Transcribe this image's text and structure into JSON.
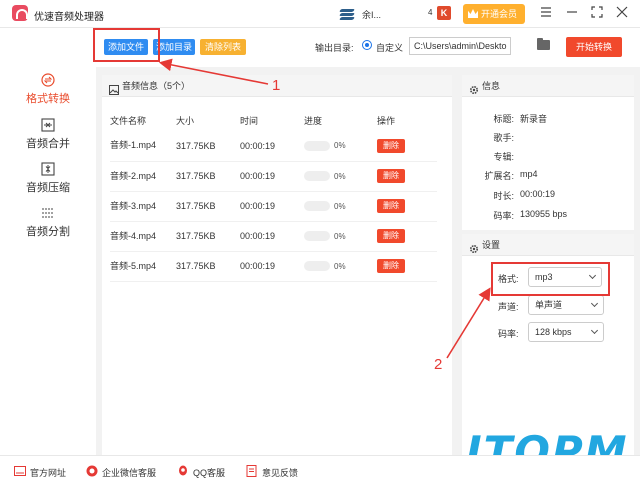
{
  "titlebar": {
    "app_title": "优速音频处理器",
    "user_name": "余I...",
    "user_suffix": "4",
    "vip_label": "开通会员",
    "icons": [
      "logo-icon",
      "user-badge-icon",
      "k-icon",
      "crown-icon",
      "menu-icon",
      "minimize-icon",
      "maximize-icon",
      "close-icon"
    ]
  },
  "sidebar": {
    "items": [
      {
        "label": "格式转换",
        "icon": "format-convert-icon",
        "active": true
      },
      {
        "label": "音频合并",
        "icon": "merge-icon",
        "active": false
      },
      {
        "label": "音频压缩",
        "icon": "compress-icon",
        "active": false
      },
      {
        "label": "音频分割",
        "icon": "split-icon",
        "active": false
      }
    ]
  },
  "toolbar": {
    "add_file": "添加文件",
    "add_dir": "添加目录",
    "clear_list": "清除列表",
    "output_label": "输出目录:",
    "custom_label": "自定义",
    "path_value": "C:\\Users\\admin\\Deskto",
    "start_label": "开始转换",
    "colors": {
      "add_file": "#2f8cf1",
      "add_dir": "#2f8cf1",
      "clear_list": "#f7b131",
      "start": "#f1492c"
    }
  },
  "file_panel": {
    "title": "音频信息（5个）",
    "columns": [
      "文件名称",
      "大小",
      "时间",
      "进度",
      "操作"
    ],
    "rows": [
      {
        "name": "音频-1.mp4",
        "size": "317.75KB",
        "time": "00:00:19",
        "progress": "0%",
        "action": "删除"
      },
      {
        "name": "音频-2.mp4",
        "size": "317.75KB",
        "time": "00:00:19",
        "progress": "0%",
        "action": "删除"
      },
      {
        "name": "音频-3.mp4",
        "size": "317.75KB",
        "time": "00:00:19",
        "progress": "0%",
        "action": "删除"
      },
      {
        "name": "音频-4.mp4",
        "size": "317.75KB",
        "time": "00:00:19",
        "progress": "0%",
        "action": "删除"
      },
      {
        "name": "音频-5.mp4",
        "size": "317.75KB",
        "time": "00:00:19",
        "progress": "0%",
        "action": "删除"
      }
    ]
  },
  "info_panel": {
    "title": "信息",
    "fields": [
      {
        "label": "标题:",
        "value": "新录音"
      },
      {
        "label": "歌手:",
        "value": ""
      },
      {
        "label": "专辑:",
        "value": ""
      },
      {
        "label": "扩展名:",
        "value": "mp4"
      },
      {
        "label": "时长:",
        "value": "00:00:19"
      },
      {
        "label": "码率:",
        "value": "130955 bps"
      }
    ]
  },
  "settings_panel": {
    "title": "设置",
    "format_label": "格式:",
    "format_value": "mp3",
    "channel_label": "声道:",
    "channel_value": "单声道",
    "bitrate_label": "码率:",
    "bitrate_value": "128 kbps"
  },
  "bottombar": {
    "items": [
      "官方网址",
      "企业微信客服",
      "QQ客服",
      "意见反馈"
    ]
  },
  "annotations": {
    "n1": "1",
    "n2": "2",
    "watermark": "ITOPM"
  }
}
